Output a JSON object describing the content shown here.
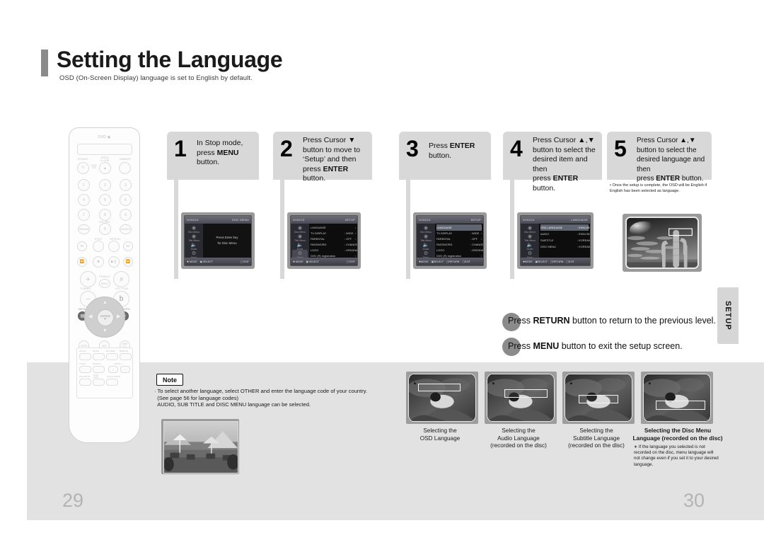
{
  "header": {
    "title": "Setting the Language",
    "subtitle": "OSD (On-Screen Display) language is set to English by default."
  },
  "steps": [
    {
      "num": "1",
      "lines": [
        "In Stop mode,",
        "press <b>MENU</b>",
        "button."
      ]
    },
    {
      "num": "2",
      "lines": [
        "Press Cursor ▼",
        "button to move to",
        "‘Setup’ and then",
        "press <b>ENTER</b> button."
      ]
    },
    {
      "num": "3",
      "lines": [
        "Press <b>ENTER</b>",
        "button."
      ]
    },
    {
      "num": "4",
      "lines": [
        "Press Cursor ▲,▼",
        "button to select the",
        "desired item and then",
        "press <b>ENTER</b> button."
      ]
    },
    {
      "num": "5",
      "lines": [
        "Press Cursor ▲,▼",
        "button to select the",
        "desired language and then",
        "press <b>ENTER</b> button."
      ]
    }
  ],
  "step5_note": "• Once the setup is complete, the OSD will be English if English has been selected as language.",
  "screens": {
    "screen1": {
      "top_left": "DVD/CD",
      "top_right": "DISC MENU",
      "sidebar": [
        "Disc Menu",
        "Title Menu",
        "Setup",
        "Setup"
      ],
      "message_line1": "Press Enter key",
      "message_line2": "for Disc Menu",
      "footer": [
        "MOVE",
        "SELECT",
        "EXIT"
      ]
    },
    "screen2": {
      "top_left": "DVD/CD",
      "top_right": "SETUP",
      "rows": [
        {
          "label": "LANGUAGE",
          "value": "",
          "selected": false
        },
        {
          "label": "TV DISPLAY",
          "value": ": WIDE",
          "selected": false
        },
        {
          "label": "PARENTAL",
          "value": ": OFF",
          "selected": false
        },
        {
          "label": "PASSWORD",
          "value": ": CHANGE",
          "selected": false
        },
        {
          "label": "LOGO",
          "value": ": ORIGINAL",
          "selected": false
        },
        {
          "label": "DVD (R) registration",
          "value": "",
          "selected": false
        }
      ],
      "footer": [
        "MOVE",
        "SELECT",
        "EXIT"
      ]
    },
    "screen3": {
      "top_left": "DVD/CD",
      "top_right": "SETUP",
      "rows": [
        {
          "label": "LANGUAGE",
          "value": "",
          "selected": true
        },
        {
          "label": "TV DISPLAY",
          "value": ": WIDE",
          "selected": false
        },
        {
          "label": "PARENTAL",
          "value": ": OFF",
          "selected": false
        },
        {
          "label": "PASSWORD",
          "value": ": CHANGE",
          "selected": false
        },
        {
          "label": "LOGO",
          "value": ": ORIGINAL",
          "selected": false
        },
        {
          "label": "DVD (R) registration",
          "value": "",
          "selected": false
        }
      ],
      "footer": [
        "MOVE",
        "SELECT",
        "RETURN",
        "EXIT"
      ]
    },
    "screen4": {
      "top_left": "DVD/CD",
      "top_right": "LANGUAGE",
      "rows": [
        {
          "label": "OSD LANGUAGE",
          "value": ": ENGLISH",
          "selected": true
        },
        {
          "label": "AUDIO",
          "value": ": ENGLISH",
          "selected": false
        },
        {
          "label": "SUBTITLE",
          "value": ": KOREAN",
          "selected": false
        },
        {
          "label": "DISC MENU",
          "value": ": KOREAN",
          "selected": false
        }
      ],
      "footer": [
        "MOVE",
        "SELECT",
        "RETURN",
        "EXIT"
      ]
    },
    "sidebar_items": [
      "Disc Menu",
      "Title Menu",
      "Audio",
      "Setup"
    ]
  },
  "press_lines": [
    "Press <b>RETURN</b> button to return to the previous level.",
    "Press <b>MENU</b> button to exit the setup screen."
  ],
  "setup_tab": "SETUP",
  "note": {
    "badge": "Note",
    "lines": [
      "· To select another language, select OTHER and enter the language code of your country.",
      "&nbsp;&nbsp;(See page 56 for language codes)",
      "&nbsp;&nbsp;AUDIO, SUB TITLE and DISC MENU language can be selected."
    ]
  },
  "thumbnails": [
    {
      "caption": [
        "Selecting the",
        "OSD Language"
      ],
      "bold": false
    },
    {
      "caption": [
        "Selecting the",
        "Audio Language",
        "(recorded on the disc)"
      ],
      "bold": false
    },
    {
      "caption": [
        "Selecting the",
        "Subtitle Language",
        "(recorded on the disc)"
      ],
      "bold": false
    },
    {
      "caption": [
        "Selecting the Disc Menu",
        "Language (recorded on the disc)"
      ],
      "bold": true
    }
  ],
  "disc_note": "∗ If the language you selected is not recorded on the disc, menu language will not change even if you set it to your desired language.",
  "page_numbers": {
    "left": "29",
    "right": "30"
  },
  "remote": {
    "logo": "DVD",
    "labels": {
      "power": "POWER",
      "open_close": "OPEN/CLOSE",
      "dimmer": "DIMMER",
      "vol_sel": "VOL/SEL",
      "step": "STEP",
      "repeat": "REPEAT",
      "menu": "MENU",
      "return": "RETURN",
      "enter": "ENTER",
      "tuner": "TUNER",
      "female": "FEMALE",
      "male": "MALE",
      "key_con": "KEY CON",
      "zoom": "ZOOM",
      "slow": "SLOW",
      "ez_view": "EZ VIEW",
      "remain": "REMAIN",
      "logo2": "LOGO",
      "digest": "DIGEST",
      "echo": "ECHO",
      "favorite": "FAVORITE",
      "disc_skip": "DISC SKIP",
      "slow_mode": "SLOW MODE"
    },
    "numbers": [
      "1",
      "2",
      "3",
      "4",
      "5",
      "6",
      "7",
      "8",
      "9",
      "0"
    ]
  },
  "colors": {
    "band": "#e2e2e2",
    "step_box": "#d8d8d8",
    "accent_bar": "#8a8a8a",
    "page_number": "#b4b4b4"
  }
}
